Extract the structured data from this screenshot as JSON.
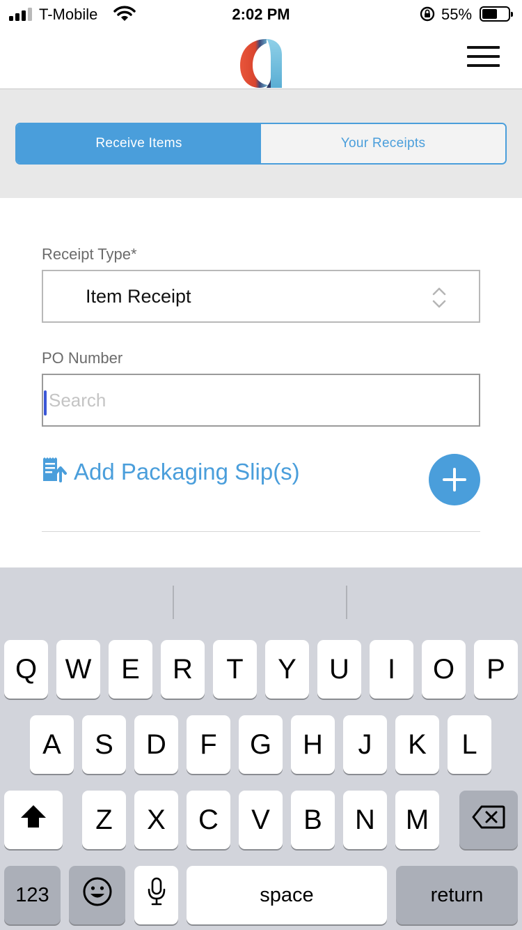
{
  "status_bar": {
    "carrier": "T-Mobile",
    "time": "2:02 PM",
    "battery_percent": "55%",
    "battery_level": 0.55,
    "signal_bars_active": 3,
    "signal_bars_total": 4
  },
  "header": {
    "logo_icon": "app-logo-icon",
    "menu_icon": "hamburger-menu-icon"
  },
  "tabs": [
    {
      "label": "Receive Items",
      "active": true
    },
    {
      "label": "Your Receipts",
      "active": false
    }
  ],
  "form": {
    "receipt_type": {
      "label": "Receipt Type*",
      "value": "Item Receipt"
    },
    "po_number": {
      "label": "PO Number",
      "placeholder": "Search",
      "value": ""
    },
    "add_packaging_slip": {
      "label": "Add Packaging Slip(s)",
      "icon": "receipt-upload-icon"
    },
    "add_button_icon": "plus-icon"
  },
  "colors": {
    "accent": "#4a9edb",
    "band_background": "#e8e8e8",
    "keyboard_background": "#d2d4db"
  },
  "keyboard": {
    "row1": [
      "Q",
      "W",
      "E",
      "R",
      "T",
      "Y",
      "U",
      "I",
      "O",
      "P"
    ],
    "row2": [
      "A",
      "S",
      "D",
      "F",
      "G",
      "H",
      "J",
      "K",
      "L"
    ],
    "row3": [
      "Z",
      "X",
      "C",
      "V",
      "B",
      "N",
      "M"
    ],
    "numbers_label": "123",
    "space_label": "space",
    "return_label": "return",
    "shift_icon": "shift-icon",
    "backspace_icon": "backspace-icon",
    "emoji_icon": "emoji-icon",
    "mic_icon": "microphone-icon"
  }
}
